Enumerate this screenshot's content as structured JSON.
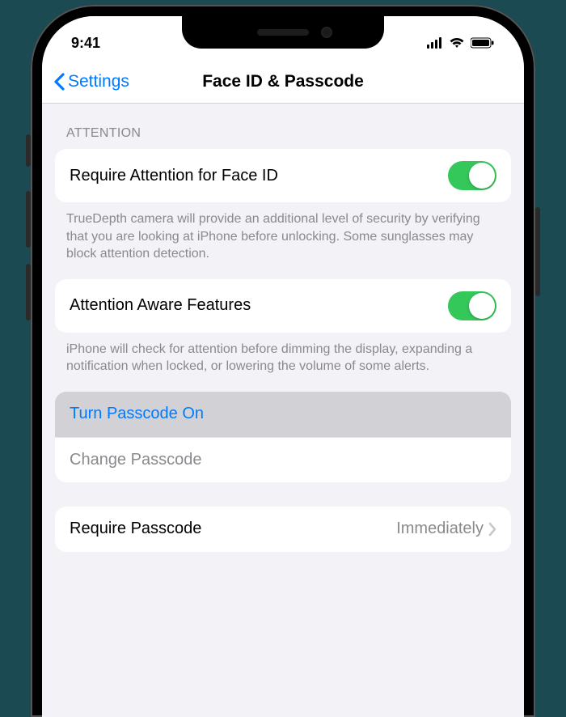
{
  "status": {
    "time": "9:41"
  },
  "nav": {
    "back_label": "Settings",
    "title": "Face ID & Passcode"
  },
  "sections": {
    "attention_header": "ATTENTION",
    "require_attention": {
      "label": "Require Attention for Face ID",
      "on": true,
      "footer": "TrueDepth camera will provide an additional level of security by verifying that you are looking at iPhone before unlocking. Some sunglasses may block attention detection."
    },
    "aware": {
      "label": "Attention Aware Features",
      "on": true,
      "footer": "iPhone will check for attention before dimming the display, expanding a notification when locked, or lowering the volume of some alerts."
    },
    "passcode": {
      "turn_on_label": "Turn Passcode On",
      "change_label": "Change Passcode"
    },
    "require_passcode": {
      "label": "Require Passcode",
      "value": "Immediately"
    }
  }
}
